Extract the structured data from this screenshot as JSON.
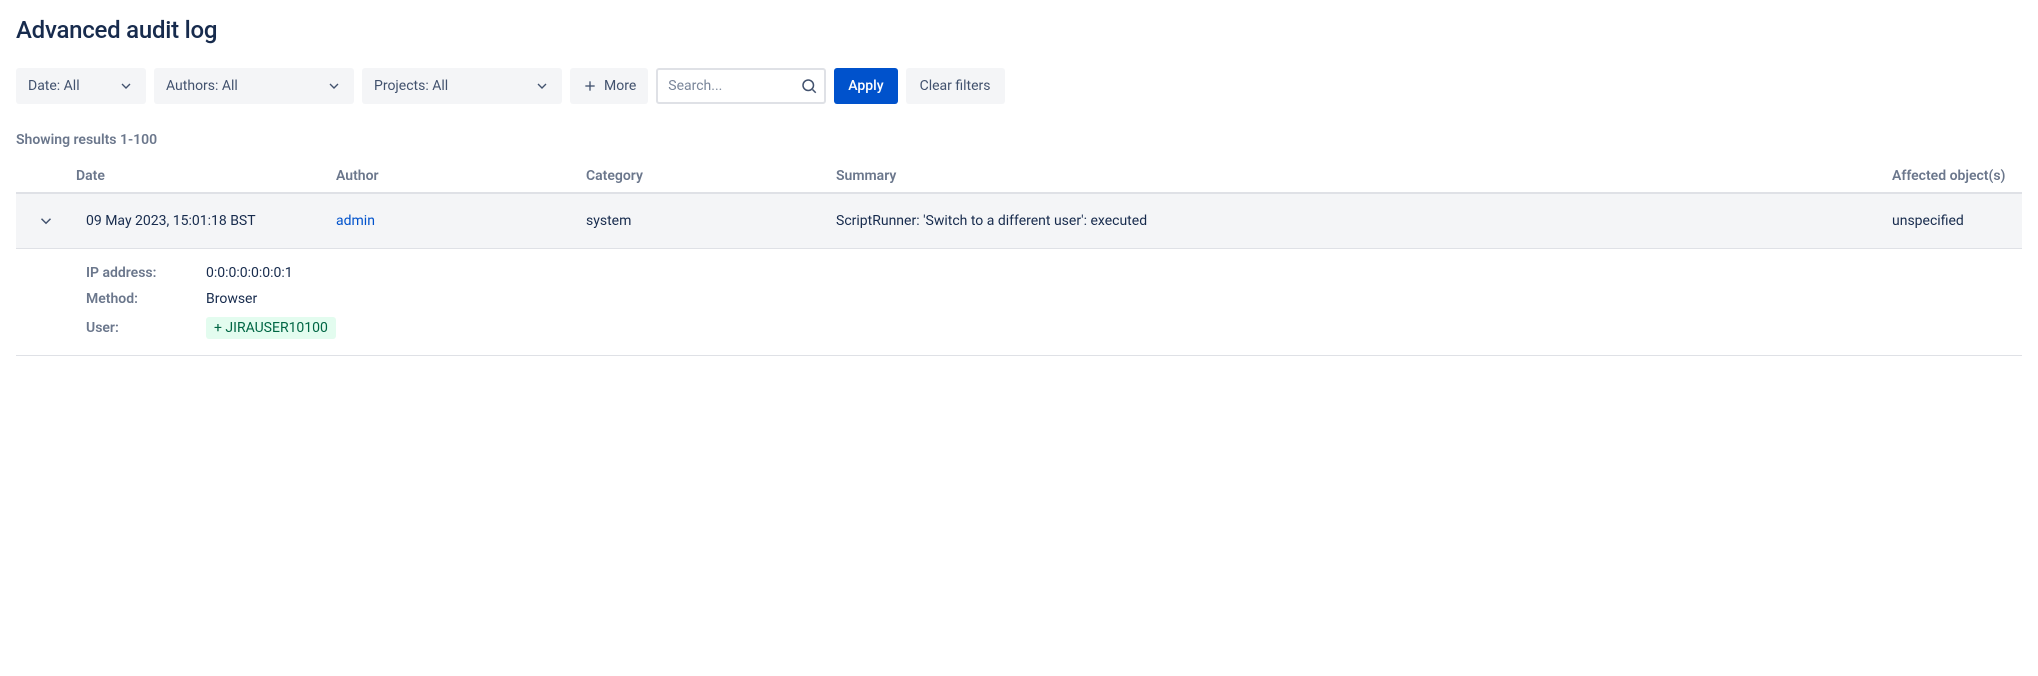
{
  "page": {
    "title": "Advanced audit log"
  },
  "filters": {
    "date_label": "Date: All",
    "authors_label": "Authors: All",
    "projects_label": "Projects: All",
    "more_label": "More",
    "search_placeholder": "Search...",
    "apply_label": "Apply",
    "clear_label": "Clear filters"
  },
  "results": {
    "count_text": "Showing results 1-100"
  },
  "table": {
    "headers": {
      "date": "Date",
      "author": "Author",
      "category": "Category",
      "summary": "Summary",
      "affected": "Affected object(s)"
    },
    "rows": [
      {
        "date": "09 May 2023, 15:01:18 BST",
        "author": "admin",
        "category": "system",
        "summary": "ScriptRunner: 'Switch to a different user': executed",
        "affected": "unspecified",
        "details": {
          "ip_label": "IP address:",
          "ip_value": "0:0:0:0:0:0:0:1",
          "method_label": "Method:",
          "method_value": "Browser",
          "user_label": "User:",
          "user_value": "+ JIRAUSER10100"
        }
      }
    ]
  }
}
